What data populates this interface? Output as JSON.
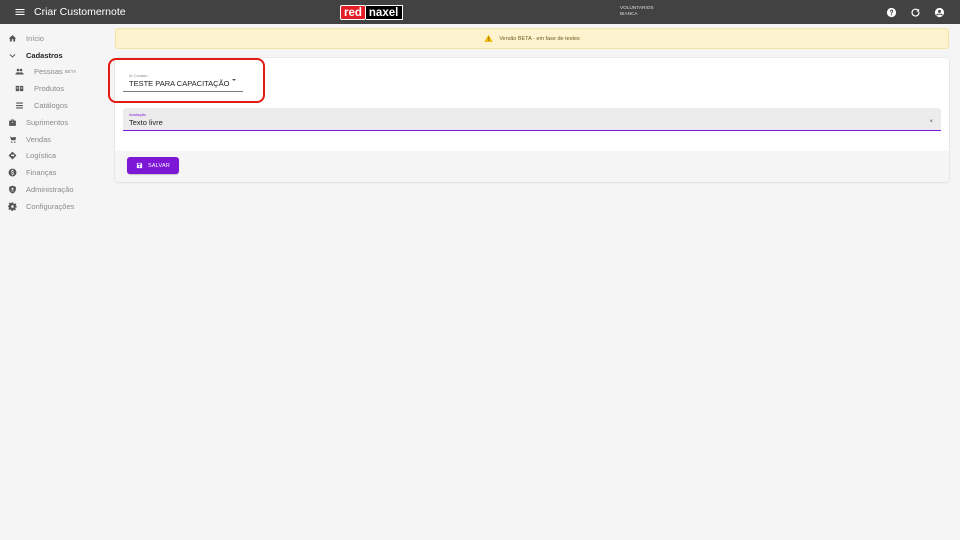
{
  "topbar": {
    "title": "Criar Customernote",
    "brand_red": "red",
    "brand_rest": "naxel",
    "user_org": "VOLUNTARIOS",
    "user_name": "BIANCA",
    "icons": [
      "menu-icon",
      "help-icon",
      "refresh-icon",
      "account-icon"
    ]
  },
  "sidebar": {
    "items": [
      {
        "label": "Início",
        "icon": "home-icon"
      },
      {
        "label": "Cadastros",
        "icon": "chevron-down-icon"
      },
      {
        "label": "Pessoas",
        "badge": "BETA",
        "icon": "people-icon"
      },
      {
        "label": "Produtos",
        "icon": "products-icon"
      },
      {
        "label": "Catálogos",
        "icon": "list-icon"
      },
      {
        "label": "Suprimentos",
        "icon": "supplies-icon"
      },
      {
        "label": "Vendas",
        "icon": "cart-icon"
      },
      {
        "label": "Logística",
        "icon": "logistics-icon"
      },
      {
        "label": "Finanças",
        "icon": "money-icon"
      },
      {
        "label": "Administração",
        "icon": "shield-icon"
      },
      {
        "label": "Configurações",
        "icon": "gear-icon"
      }
    ]
  },
  "banner": {
    "text": "Versão BETA - em fase de testes",
    "icon": "warning-icon"
  },
  "form": {
    "contact_label": "Id Contato",
    "contact_value": "TESTE PARA CAPACITAÇÃO",
    "note_label": "Anotação",
    "note_value": "Texto livre",
    "clear_symbol": "×",
    "save_label": "SALVAR"
  },
  "colors": {
    "topbar": "#424242",
    "accent": "#7c17d6",
    "banner_bg": "#fdf3cf",
    "highlight": "#e31a12",
    "brand_red": "#e41e26"
  }
}
